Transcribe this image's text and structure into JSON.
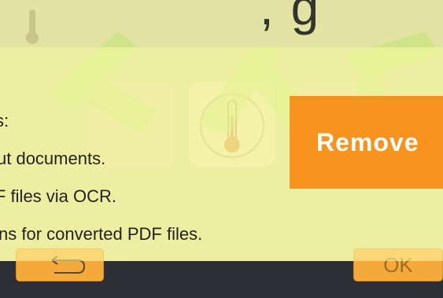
{
  "app": {
    "title": ", g",
    "ok_label": "OK"
  },
  "promo": {
    "lines": [
      "s:",
      "ut documents.",
      "F files via OCR.",
      "ns for converted PDF files."
    ],
    "remove_label": "Remove"
  },
  "colors": {
    "accent": "#f7931e",
    "button": "#f4a93a",
    "overlay": "#ffffaa",
    "bottom_bar": "#2e2e36"
  }
}
